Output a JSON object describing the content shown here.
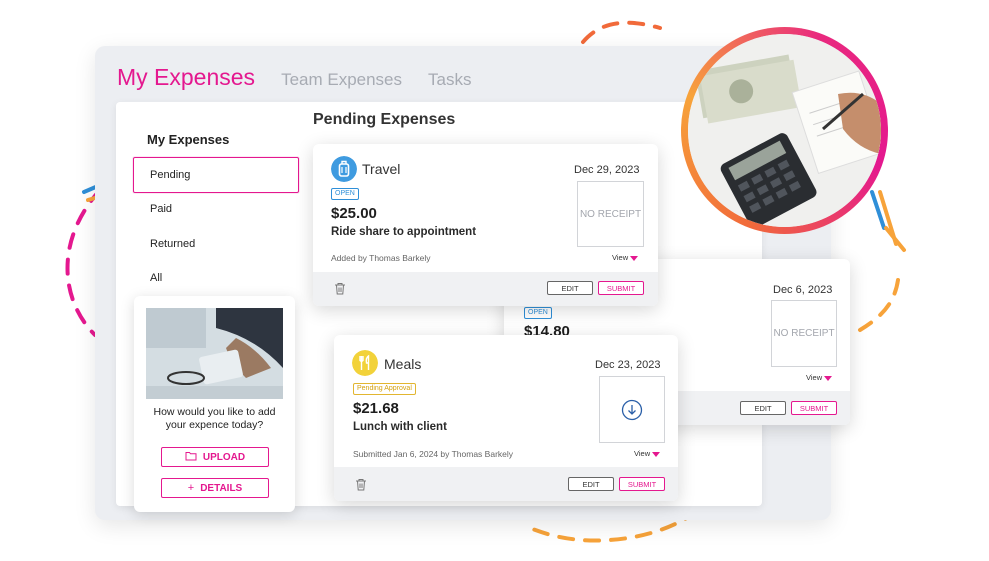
{
  "app": {
    "tabs": [
      "My Expenses",
      "Team Expenses",
      "Tasks"
    ],
    "active_tab": "My Expenses"
  },
  "sidebar": {
    "title": "My Expenses",
    "items": [
      {
        "label": "Pending",
        "active": true
      },
      {
        "label": "Paid",
        "active": false
      },
      {
        "label": "Returned",
        "active": false
      },
      {
        "label": "All",
        "active": false
      }
    ]
  },
  "main": {
    "section_title": "Pending Expenses"
  },
  "expenses": [
    {
      "category": "Travel",
      "category_icon": "luggage-icon",
      "status": "OPEN",
      "amount": "$25.00",
      "description": "Ride share to appointment",
      "meta": "Added by Thomas Barkely",
      "date": "Dec 29, 2023",
      "receipt": "NO RECEIPT",
      "view_label": "View",
      "edit_label": "EDIT",
      "submit_label": "SUBMIT"
    },
    {
      "category": "",
      "status": "OPEN",
      "amount": "$14.80",
      "date": "Dec 6, 2023",
      "receipt": "NO RECEIPT",
      "view_label": "View",
      "edit_label": "EDIT",
      "submit_label": "SUBMIT"
    },
    {
      "category": "Meals",
      "category_icon": "utensils-icon",
      "status": "Pending Approval",
      "amount": "$21.68",
      "description": "Lunch with client",
      "meta": "Submitted Jan 6, 2024 by Thomas Barkely",
      "date": "Dec 23, 2023",
      "receipt_icon": "download-icon",
      "view_label": "View",
      "edit_label": "EDIT",
      "submit_label": "SUBMIT"
    }
  ],
  "upload_card": {
    "question": "How would you like to add your expence today?",
    "upload_label": "UPLOAD",
    "details_label": "DETAILS"
  },
  "colors": {
    "accent": "#e4188f",
    "orange": "#f7a33a",
    "open_blue": "#2f8fd8",
    "pending_yellow": "#e2b630",
    "travel_icon": "#3f9be0",
    "meals_icon": "#f2d23a"
  }
}
